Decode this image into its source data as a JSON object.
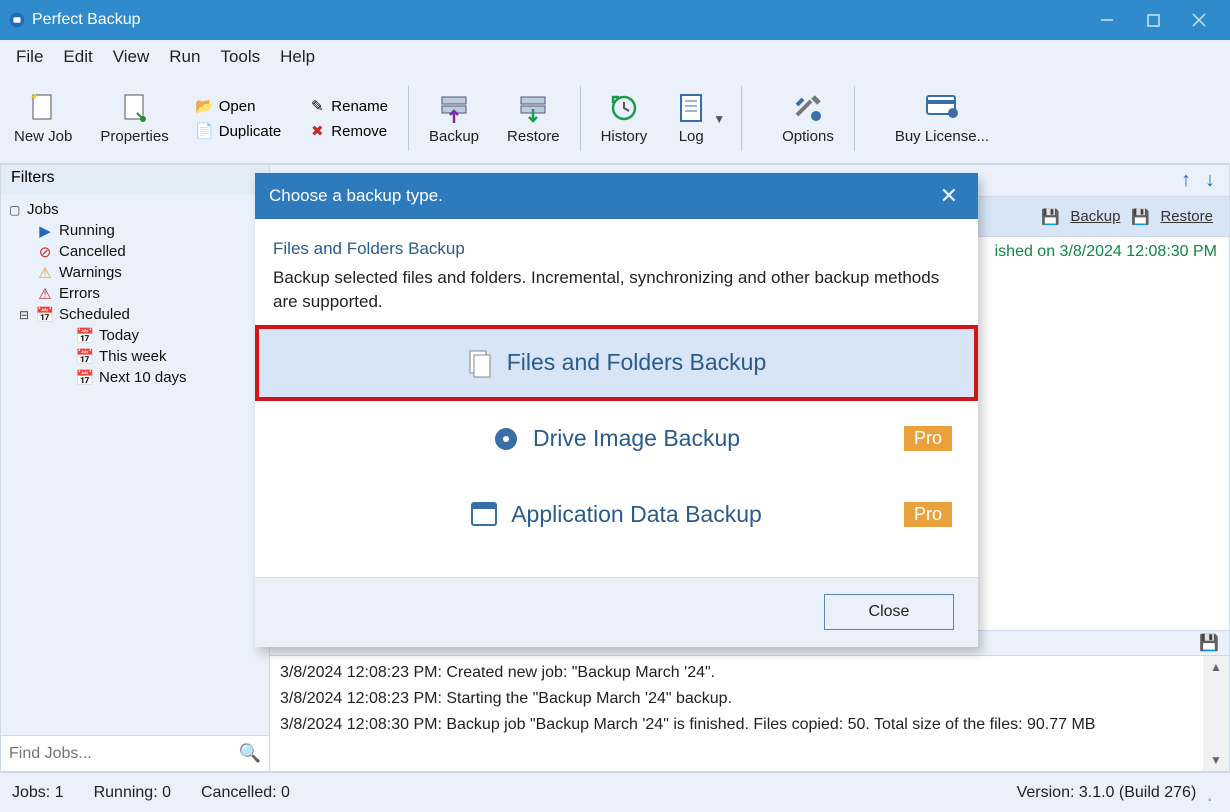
{
  "titlebar": {
    "title": "Perfect Backup"
  },
  "menu": {
    "file": "File",
    "edit": "Edit",
    "view": "View",
    "run": "Run",
    "tools": "Tools",
    "help": "Help"
  },
  "toolbar": {
    "newjob": "New Job",
    "properties": "Properties",
    "open": "Open",
    "duplicate": "Duplicate",
    "rename": "Rename",
    "remove": "Remove",
    "backup": "Backup",
    "restore": "Restore",
    "history": "History",
    "log": "Log",
    "options": "Options",
    "buy": "Buy License..."
  },
  "filters": {
    "header": "Filters",
    "jobs": "Jobs",
    "running": "Running",
    "cancelled": "Cancelled",
    "warnings": "Warnings",
    "errors": "Errors",
    "scheduled": "Scheduled",
    "today": "Today",
    "thisweek": "This week",
    "next10": "Next 10 days",
    "search_placeholder": "Find Jobs..."
  },
  "joblist": {
    "backup_link": "Backup",
    "restore_link": "Restore",
    "status": "ished on 3/8/2024 12:08:30 PM"
  },
  "log": {
    "l1": "3/8/2024 12:08:23 PM: Created new job: \"Backup March '24\".",
    "l2": "3/8/2024 12:08:23 PM: Starting the \"Backup March '24\" backup.",
    "l3": "3/8/2024 12:08:30 PM: Backup job \"Backup March '24\" is finished. Files copied: 50. Total size of the files: 90.77 MB"
  },
  "statusbar": {
    "jobs": "Jobs: 1",
    "running": "Running: 0",
    "cancelled": "Cancelled: 0",
    "version": "Version: 3.1.0 (Build 276)"
  },
  "modal": {
    "title": "Choose a backup type.",
    "desc_title": "Files and Folders Backup",
    "desc_body": "Backup selected files and folders. Incremental, synchronizing and other backup methods are supported.",
    "opt1": "Files and Folders Backup",
    "opt2": "Drive Image Backup",
    "opt3": "Application Data Backup",
    "pro": "Pro",
    "close": "Close"
  }
}
